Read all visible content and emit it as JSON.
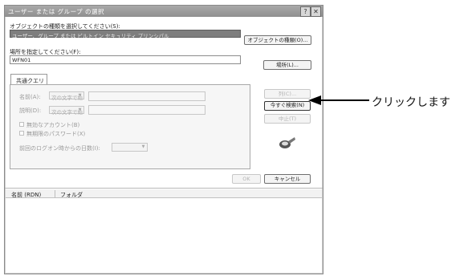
{
  "window": {
    "title": "ユーザー または グループ の選択",
    "help_button": "?",
    "close_button": "✕"
  },
  "object_type": {
    "label": "オブジェクトの種類を選択してください(S):",
    "value": "ユーザー、グループ または ビルトイン セキュリティ プリンシパル",
    "button": "オブジェクトの種類(O)..."
  },
  "location": {
    "label": "場所を指定してください(F):",
    "value": "WFN01",
    "button": "場所(L)..."
  },
  "query_tab": {
    "label": "共通クエリ"
  },
  "query": {
    "name_label": "名前(A):",
    "name_op": "次の文字で始",
    "desc_label": "説明(D):",
    "desc_op": "次の文字で始",
    "disabled_accounts": "無効なアカウント(B)",
    "non_expiring_password": "無期限のパスワード(X)",
    "days_since_logon": "前回のログオン時からの日数(I):"
  },
  "right_buttons": {
    "columns": "列(C)...",
    "find_now": "今すぐ検索(N)",
    "stop": "中止(T)"
  },
  "bottom_buttons": {
    "ok": "OK",
    "cancel": "キャンセル"
  },
  "results_header": {
    "col_name": "名前 (RDN)",
    "col_folder": "フォルダ"
  },
  "callout": {
    "text": "クリックします"
  }
}
